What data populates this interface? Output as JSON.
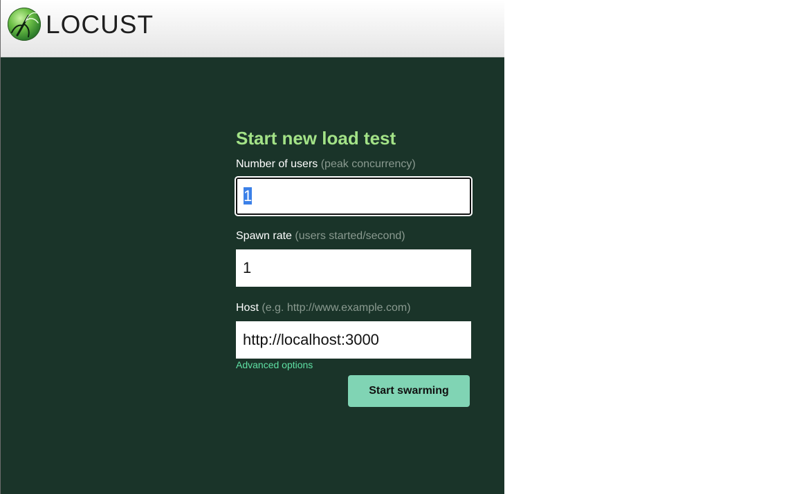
{
  "header": {
    "logo_text": "LOCUST",
    "logo_icon": "locust-logo-icon"
  },
  "form": {
    "title": "Start new load test",
    "users": {
      "label": "Number of users",
      "hint": "(peak concurrency)",
      "value": "1"
    },
    "spawn_rate": {
      "label": "Spawn rate",
      "hint": "(users started/second)",
      "value": "1"
    },
    "host": {
      "label": "Host",
      "hint": "(e.g. http://www.example.com)",
      "value": "http://localhost:3000"
    },
    "advanced_link": "Advanced options",
    "start_button": "Start swarming"
  },
  "colors": {
    "background": "#1a3429",
    "title": "#a3e287",
    "hint": "#8a9a90",
    "link": "#5fe0a4",
    "button": "#80d4b4",
    "selection": "#3b80e8"
  }
}
